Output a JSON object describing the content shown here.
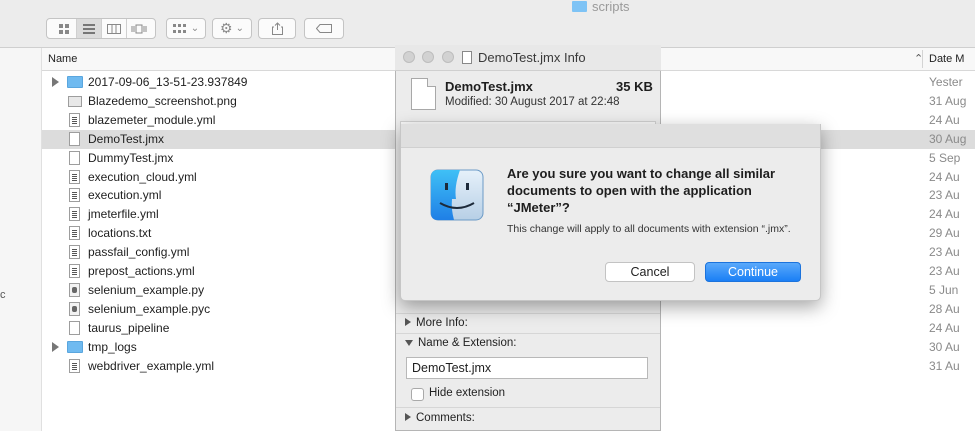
{
  "window": {
    "folder_title": "scripts"
  },
  "list": {
    "header_name": "Name",
    "header_date": "Date M",
    "rows": [
      {
        "name": "2017-09-06_13-51-23.937849",
        "date": "Yester",
        "icon": "folder-icon",
        "expandable": true,
        "selected": false
      },
      {
        "name": "Blazedemo_screenshot.png",
        "date": "31 Aug",
        "icon": "image-file-icon",
        "expandable": false,
        "selected": false
      },
      {
        "name": "blazemeter_module.yml",
        "date": "24 Au",
        "icon": "text-file-icon",
        "expandable": false,
        "selected": false
      },
      {
        "name": "DemoTest.jmx",
        "date": "30 Aug",
        "icon": "blank-file-icon",
        "expandable": false,
        "selected": true
      },
      {
        "name": "DummyTest.jmx",
        "date": "5 Sep",
        "icon": "blank-file-icon",
        "expandable": false,
        "selected": false
      },
      {
        "name": "execution_cloud.yml",
        "date": "24 Au",
        "icon": "text-file-icon",
        "expandable": false,
        "selected": false
      },
      {
        "name": "execution.yml",
        "date": "23 Au",
        "icon": "text-file-icon",
        "expandable": false,
        "selected": false
      },
      {
        "name": "jmeterfile.yml",
        "date": "24 Au",
        "icon": "text-file-icon",
        "expandable": false,
        "selected": false
      },
      {
        "name": "locations.txt",
        "date": "29 Au",
        "icon": "text-file-icon",
        "expandable": false,
        "selected": false
      },
      {
        "name": "passfail_config.yml",
        "date": "23 Au",
        "icon": "text-file-icon",
        "expandable": false,
        "selected": false
      },
      {
        "name": "prepost_actions.yml",
        "date": "23 Au",
        "icon": "text-file-icon",
        "expandable": false,
        "selected": false
      },
      {
        "name": "selenium_example.py",
        "date": "5 Jun",
        "icon": "python-file-icon",
        "expandable": false,
        "selected": false
      },
      {
        "name": "selenium_example.pyc",
        "date": "28 Au",
        "icon": "python-file-icon",
        "expandable": false,
        "selected": false
      },
      {
        "name": "taurus_pipeline",
        "date": "24 Au",
        "icon": "blank-file-icon",
        "expandable": false,
        "selected": false
      },
      {
        "name": "tmp_logs",
        "date": "30 Au",
        "icon": "folder-icon",
        "expandable": true,
        "selected": false
      },
      {
        "name": "webdriver_example.yml",
        "date": "31 Au",
        "icon": "text-file-icon",
        "expandable": false,
        "selected": false
      }
    ]
  },
  "info": {
    "title": "DemoTest.jmx Info",
    "file_name": "DemoTest.jmx",
    "size": "35 KB",
    "modified": "Modified: 30 August 2017 at 22:48",
    "more_info": "More Info:",
    "name_extension": "Name & Extension:",
    "name_value": "DemoTest.jmx",
    "hide_extension": "Hide extension",
    "comments": "Comments:"
  },
  "alert": {
    "title": "Are you sure you want to change all similar documents to open with the application “JMeter”?",
    "message": "This change will apply to all documents with extension “.jmx”.",
    "cancel": "Cancel",
    "continue": "Continue"
  },
  "colors": {
    "selection": "#dcdcdc",
    "accent": "#1a7ff5",
    "folder": "#6fbaf0"
  }
}
